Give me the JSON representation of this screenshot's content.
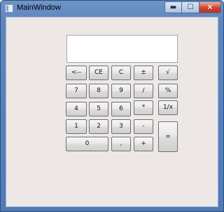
{
  "window": {
    "title": "MainWindow"
  },
  "caption": {
    "min": "▬",
    "max": "☐",
    "close": "✕"
  },
  "display": {
    "value": ""
  },
  "keys": {
    "backspace": "<--",
    "ce": "CE",
    "c": "C",
    "plusminus": "±",
    "sqrt": "√",
    "seven": "7",
    "eight": "8",
    "nine": "9",
    "divide": "/",
    "percent": "%",
    "four": "4",
    "five": "5",
    "six": "6",
    "multiply": "*",
    "reciprocal": "1/x",
    "one": "1",
    "two": "2",
    "three": "3",
    "minus": "-",
    "equals": "=",
    "zero": "0",
    "comma": ",",
    "plus": "+"
  }
}
